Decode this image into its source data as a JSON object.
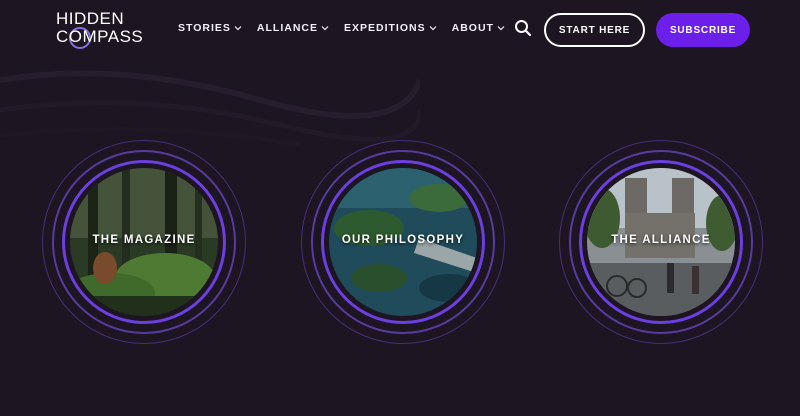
{
  "logo": {
    "line1": "HIDDEN",
    "line2": "COMPASS"
  },
  "nav": {
    "items": [
      {
        "label": "STORIES"
      },
      {
        "label": "ALLIANCE"
      },
      {
        "label": "EXPEDITIONS"
      },
      {
        "label": "ABOUT"
      }
    ]
  },
  "header": {
    "start_label": "START HERE",
    "subscribe_label": "SUBSCRIBE"
  },
  "cards": [
    {
      "label": "THE MAGAZINE",
      "image": "forest-explorer"
    },
    {
      "label": "OUR PHILOSOPHY",
      "image": "aerial-lake"
    },
    {
      "label": "THE ALLIANCE",
      "image": "notre-dame-street"
    }
  ],
  "colors": {
    "background": "#1d1521",
    "accent": "#6c1fe8",
    "ring": "#6b3fe0"
  }
}
